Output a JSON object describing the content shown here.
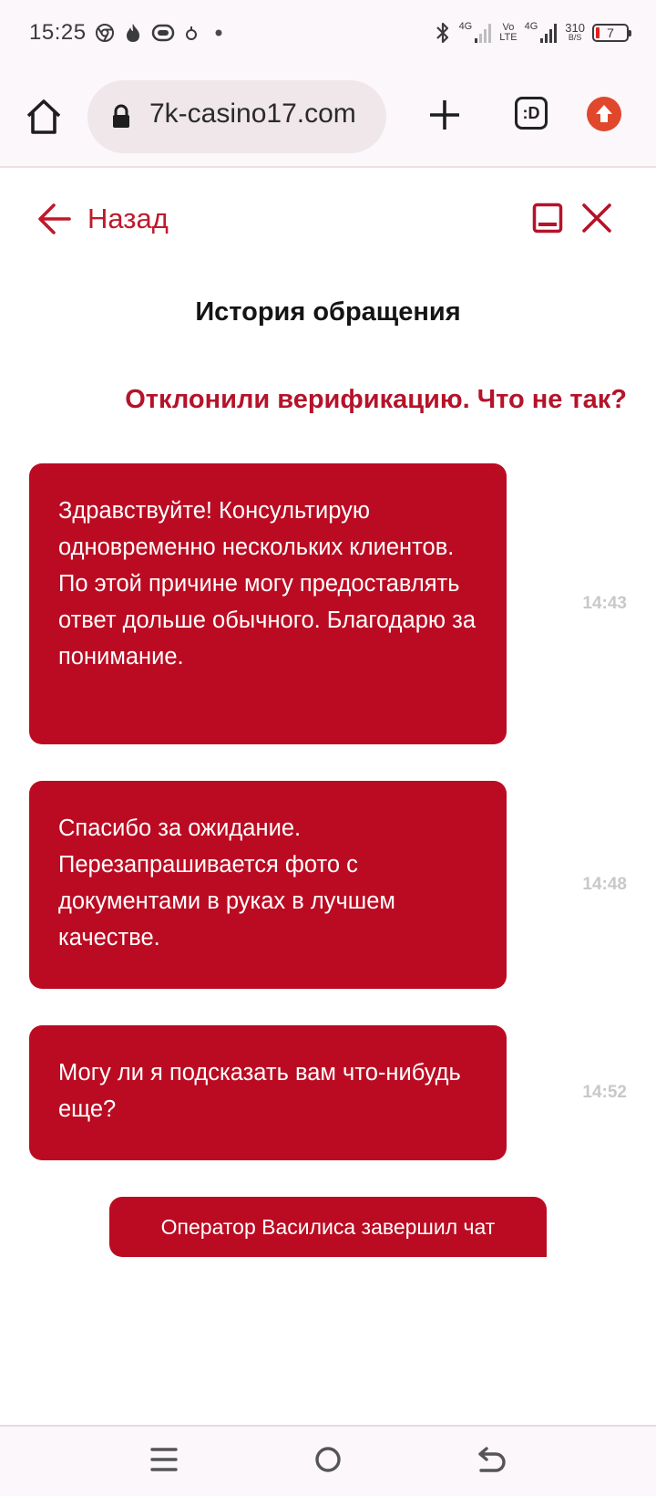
{
  "status_bar": {
    "time": "15:25",
    "left_icons": [
      "chrome-icon",
      "fire-icon",
      "link-icon",
      "drop-icon",
      "dot-icon"
    ],
    "network_1": "4G",
    "volte_top": "Vo",
    "volte_bottom": "LTE",
    "network_2": "4G",
    "speed_value": "310",
    "speed_unit": "B/S",
    "battery": "7"
  },
  "browser": {
    "url": "7k-casino17.com",
    "tabs_label": ":D"
  },
  "chat": {
    "back_label": "Назад",
    "title": "История обращения",
    "topic": "Отклонили верификацию. Что не так?",
    "messages": [
      {
        "text": "Здравствуйте! Консультирую одновременно нескольких клиентов. По этой причине могу предоставлять ответ дольше обычного. Благодарю за понимание.",
        "time": "14:43"
      },
      {
        "text": "Спасибо за ожидание. Перезапрашивается фото с документами в руках в лучшем качестве.",
        "time": "14:48"
      },
      {
        "text": "Могу ли я подсказать вам что-нибудь еще?",
        "time": "14:52"
      }
    ],
    "system_note": "Оператор Василиса завершил чат"
  },
  "colors": {
    "accent": "#bb0b22",
    "accent_text": "#b5132a",
    "time_gray": "#c8c8c8",
    "browser_bg": "#fcf7fa"
  }
}
